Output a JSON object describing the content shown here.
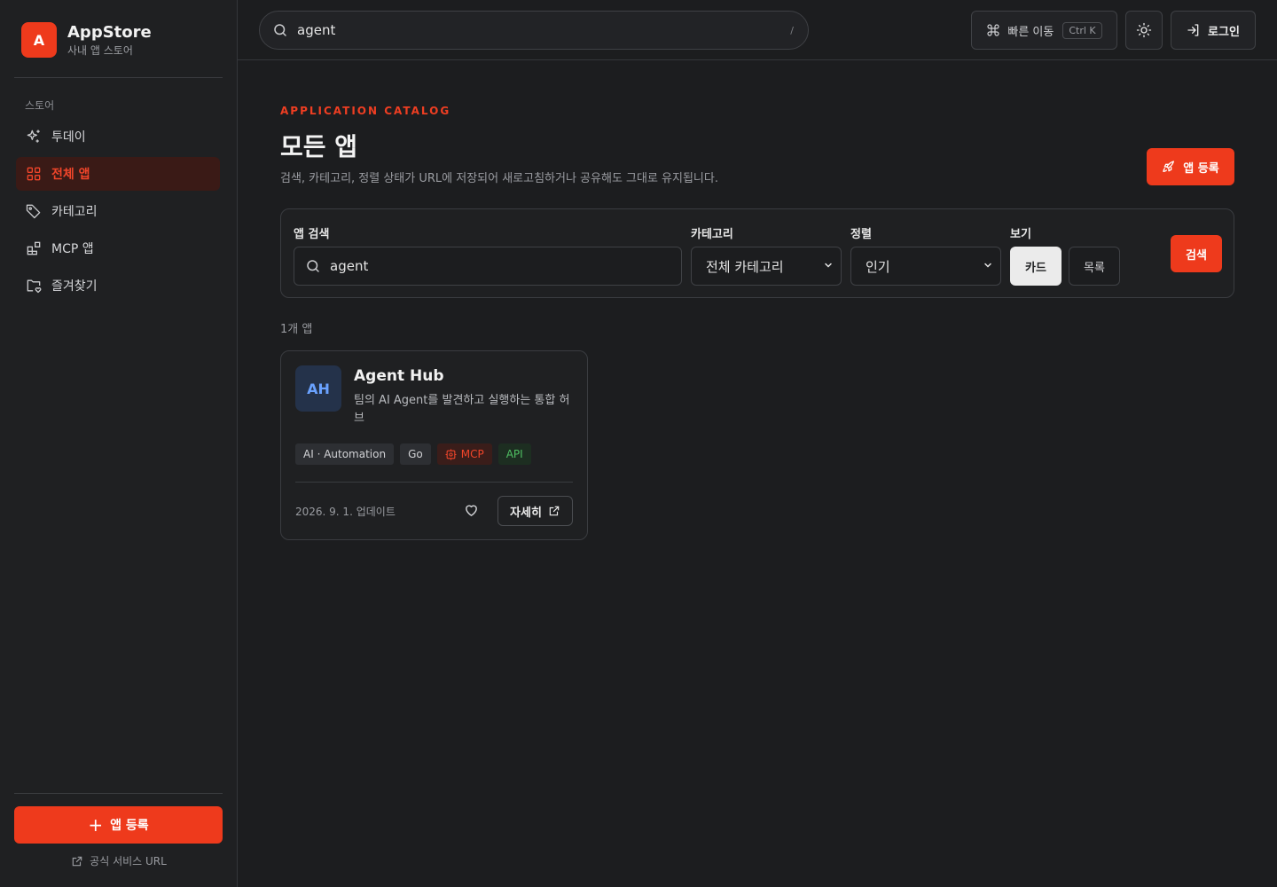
{
  "brand": {
    "logo_letter": "A",
    "title": "AppStore",
    "subtitle": "사내 앱 스토어"
  },
  "sidebar": {
    "section_label": "스토어",
    "items": [
      {
        "label": "투데이",
        "icon": "sparkles-icon",
        "active": false
      },
      {
        "label": "전체 앱",
        "icon": "grid-icon",
        "active": true
      },
      {
        "label": "카테고리",
        "icon": "tag-icon",
        "active": false
      },
      {
        "label": "MCP 앱",
        "icon": "blocks-icon",
        "active": false
      },
      {
        "label": "즐겨찾기",
        "icon": "folder-heart-icon",
        "active": false
      }
    ],
    "cta_label": "앱 등록",
    "footer_link": "공식 서비스 URL"
  },
  "topbar": {
    "search_value": "agent",
    "search_shortcut": "/",
    "quick_nav_label": "빠른 이동",
    "quick_nav_kbd": "Ctrl K",
    "login_label": "로그인"
  },
  "header": {
    "eyebrow": "APPLICATION CATALOG",
    "title": "모든 앱",
    "description": "검색, 카테고리, 정렬 상태가 URL에 저장되어 새로고침하거나 공유해도 그대로 유지됩니다.",
    "register_label": "앱 등록"
  },
  "filters": {
    "search_label": "앱 검색",
    "search_value": "agent",
    "category_label": "카테고리",
    "category_selected": "전체 카테고리",
    "sort_label": "정렬",
    "sort_selected": "인기",
    "view_label": "보기",
    "view_card": "카드",
    "view_list": "목록",
    "view_selected": "카드",
    "submit_label": "검색"
  },
  "results": {
    "count_text": "1개 앱",
    "apps": [
      {
        "initials": "AH",
        "name": "Agent Hub",
        "description": "팀의 AI Agent를 발견하고 실행하는 통합 허브",
        "tags": [
          {
            "label": "AI · Automation",
            "kind": "default"
          },
          {
            "label": "Go",
            "kind": "default"
          },
          {
            "label": "MCP",
            "kind": "mcp"
          },
          {
            "label": "API",
            "kind": "api"
          }
        ],
        "updated": "2026. 9. 1. 업데이트",
        "detail_label": "자세히"
      }
    ]
  },
  "colors": {
    "accent": "#ee3a1c",
    "background": "#1c1d1f",
    "sidebar": "#1f2022",
    "active_nav_bg": "#3a1a16",
    "mcp_tag": "#f0452a",
    "api_tag": "#4fbf62",
    "avatar_text": "#6aa2ff"
  }
}
